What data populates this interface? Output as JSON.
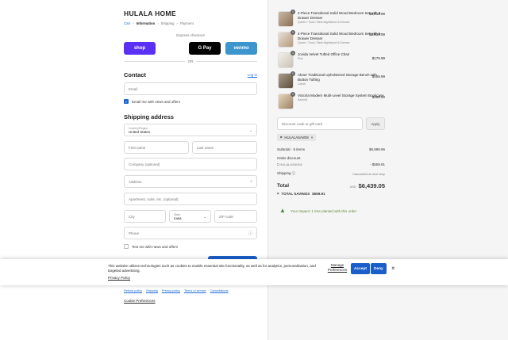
{
  "brand": "HULALA HOME",
  "breadcrumbs": {
    "cart": "Cart",
    "information": "Information",
    "shipping": "Shipping",
    "payment": "Payment",
    "separator": "›"
  },
  "express": {
    "label": "Express checkout",
    "shop": "shop",
    "gpay": "G Pay",
    "venmo": "venmo",
    "or": "OR"
  },
  "contact": {
    "title": "Contact",
    "login": "Log in",
    "email_placeholder": "Email",
    "news_label": "Email me with news and offers"
  },
  "shipping_address": {
    "title": "Shipping address",
    "country_label": "Country/Region",
    "country_value": "United States",
    "first_name": "First name",
    "last_name": "Last name",
    "company": "Company (optional)",
    "address": "Address",
    "apartment": "Apartment, suite, etc. (optional)",
    "city": "City",
    "state_label": "State",
    "state_value": "Iowa",
    "zip": "ZIP code",
    "phone": "Phone",
    "text_label": "Text me with news and offers"
  },
  "footer": {
    "links": [
      "Refund policy",
      "Shipping",
      "Privacy policy",
      "Terms of service",
      "Cancellations"
    ],
    "cookie_preferences": "Cookie Preferences"
  },
  "cart_items": [
    {
      "qty": "1",
      "title": "4-Piece Transitional Solid Wood Bedroom Set with 6-Drawer Dresser",
      "variant": "Queen / Tools / Best-Nightstand 6-Dresser",
      "price": "$3,019.99"
    },
    {
      "qty": "1",
      "title": "4-Piece Transitional Solid Wood Bedroom Set with 6-Drawer Dresser",
      "variant": "Queen / Tools / Best-Nightstand 6-Dresser",
      "price": "$2,839.99"
    },
    {
      "qty": "1",
      "title": "Jovida Velvet Tufted Office Chair",
      "variant": "Pink",
      "price": "$179.99"
    },
    {
      "qty": "1",
      "title": "Abner Traditional Upholstered Storage Bench with Button Tufting",
      "variant": "Camel",
      "price": "$459.99"
    },
    {
      "qty": "1",
      "title": "Victoria Modern Multi-Level Storage System Bookcase",
      "variant": "Sawmill",
      "price": "$499.00"
    }
  ],
  "discount": {
    "placeholder": "Discount code or gift card",
    "apply": "Apply",
    "tag": "HULALASAVE8",
    "tag_close": "×"
  },
  "summary": {
    "subtotal_label": "Subtotal · 5 items",
    "subtotal_value": "$6,999.96",
    "order_discount": "Order discount",
    "discount_code": "HULALASAVE8",
    "discount_value": "- $559.91",
    "shipping_label": "Shipping",
    "shipping_value": "Calculated at next step",
    "total_label": "Total",
    "currency": "USD",
    "total_value": "$6,439.05",
    "savings_label": "TOTAL SAVINGS",
    "savings_value": "$559.91"
  },
  "impact": "Your Impact: 1 tree planted with this order",
  "cookie_banner": {
    "text": "This website utilizes technologies such as cookies to enable essential site functionality, as well as for analytics, personalization, and targeted advertising.",
    "privacy": "Privacy Policy",
    "manage": "Manage Preferences",
    "accept": "Accept",
    "deny": "Deny",
    "close": "×"
  },
  "colors": {
    "accent": "#1a5fc9",
    "shop": "#5a31f4",
    "venmo": "#3d95ce"
  }
}
